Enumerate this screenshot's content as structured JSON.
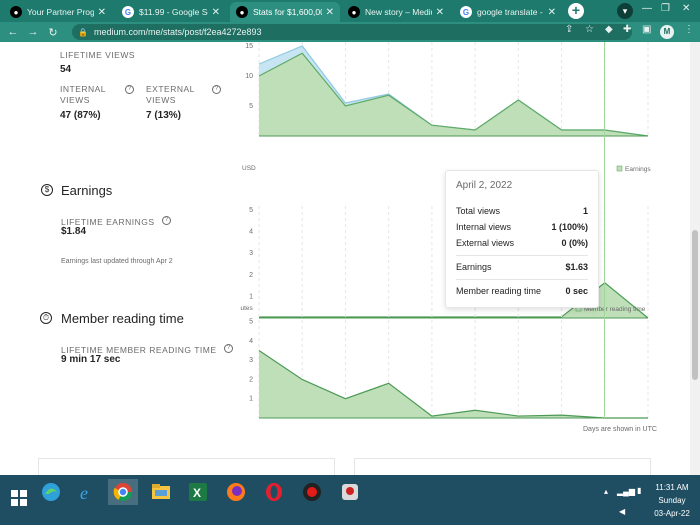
{
  "browser": {
    "tabs": [
      {
        "label": "Your Partner Program",
        "favicon": "medium-icon"
      },
      {
        "label": "$11.99 - Google Searc",
        "favicon": "google-icon"
      },
      {
        "label": "Stats for $1,600,000,0",
        "favicon": "medium-icon"
      },
      {
        "label": "New story – Medium",
        "favicon": "medium-icon"
      },
      {
        "label": "google translate - Goo",
        "favicon": "google-icon"
      }
    ],
    "active_tab": 2,
    "url": "medium.com/me/stats/post/f2ea4272e893",
    "profile_initial": "M"
  },
  "views": {
    "lifetime_label": "LIFETIME VIEWS",
    "lifetime_value": "54",
    "internal_label_1": "INTERNAL",
    "internal_label_2": "VIEWS",
    "internal_value": "47 (87%)",
    "external_label_1": "EXTERNAL",
    "external_label_2": "VIEWS",
    "external_value": "7 (13%)"
  },
  "earnings": {
    "title": "Earnings",
    "icon_glyph": "$",
    "lifetime_label": "LIFETIME EARNINGS",
    "lifetime_value": "$1.84",
    "note": "Earnings last updated through Apr 2",
    "unit": "USD",
    "legend": "Earnings"
  },
  "reading_time": {
    "title": "Member reading time",
    "lifetime_label": "LIFETIME MEMBER READING TIME",
    "lifetime_value": "9 min 17 sec",
    "unit": "Minutes",
    "legend": "Member reading time",
    "footnote": "Days are shown in UTC"
  },
  "tooltip": {
    "date": "April 2, 2022",
    "rows": [
      {
        "label": "Total views",
        "value": "1"
      },
      {
        "label": "Internal views",
        "value": "1 (100%)"
      },
      {
        "label": "External views",
        "value": "0 (0%)"
      },
      {
        "label": "Earnings",
        "value": "$1.63"
      },
      {
        "label": "Member reading time",
        "value": "0 sec"
      }
    ]
  },
  "colors": {
    "internal_fill": "#bfdfb9",
    "internal_stroke": "#5ea965",
    "external_fill": "#c6e4f2",
    "chart_fill": "#bfdfb9",
    "chart_stroke": "#4c9a55",
    "cursor_line": "#9fd69a"
  },
  "chart_data": [
    {
      "type": "area",
      "title": "Views",
      "yticks": [
        "5",
        "10",
        "15"
      ],
      "ylim": [
        0,
        15
      ],
      "series": [
        {
          "name": "Internal",
          "values": [
            10,
            13.8,
            5,
            6.8,
            1.8,
            1,
            6,
            1,
            1,
            0
          ]
        },
        {
          "name": "External",
          "values": [
            12,
            15,
            5.5,
            7,
            1.8,
            1,
            6,
            1,
            1,
            0
          ]
        }
      ]
    },
    {
      "type": "area",
      "title": "Earnings",
      "yticks": [
        "1",
        "2",
        "3",
        "4",
        "5"
      ],
      "ylim": [
        0,
        5
      ],
      "series": [
        {
          "name": "Earnings",
          "values": [
            0.05,
            0.05,
            0.05,
            0.05,
            0.05,
            0.05,
            0.05,
            0.05,
            1.63,
            0
          ]
        }
      ]
    },
    {
      "type": "area",
      "title": "Member reading time",
      "yticks": [
        "1",
        "2",
        "3",
        "4",
        "5"
      ],
      "ylim": [
        0,
        5.5
      ],
      "series": [
        {
          "name": "Member reading time",
          "values": [
            3.5,
            2,
            1,
            1.8,
            0.1,
            0.4,
            0.1,
            0.15,
            0,
            0
          ]
        }
      ]
    }
  ],
  "taskbar": {
    "time": "11:31 AM",
    "day": "Sunday",
    "date": "03-Apr-22"
  }
}
